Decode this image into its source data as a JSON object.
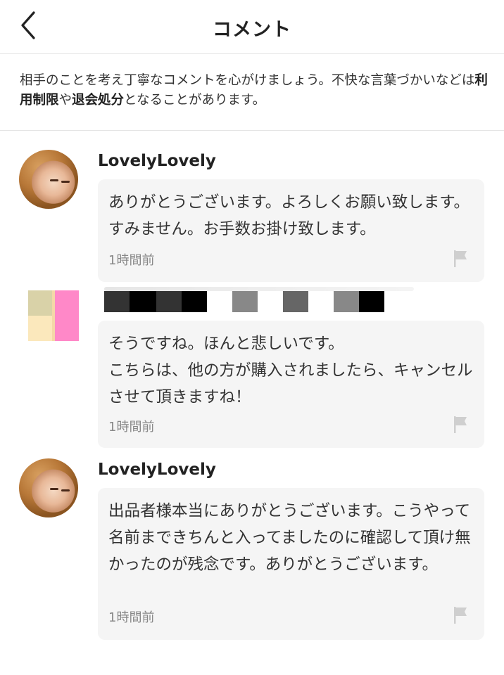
{
  "header": {
    "title": "コメント"
  },
  "notice": {
    "part1": "相手のことを考え丁寧なコメントを心がけましょう。不快な言葉づかいなどは",
    "bold1": "利用制限",
    "part2": "や",
    "bold2": "退会処分",
    "part3": "となることがあります。"
  },
  "comments": [
    {
      "username": "LovelyLovely",
      "text": "ありがとうございます。よろしくお願い致します。すみません。お手数お掛け致します。",
      "time": "1時間前"
    },
    {
      "username": "",
      "text": "そうですね。ほんと悲しいです。\nこちらは、他の方が購入されましたら、キャンセルさせて頂きますね！",
      "time": "1時間前"
    },
    {
      "username": "LovelyLovely",
      "text": "出品者様本当にありがとうございます。こうやって名前まできちんと入ってましたのに確認して頂け無かったのが残念です。ありがとうございます。",
      "time": "1時間前"
    }
  ],
  "icons": {
    "back": "chevron-left-icon",
    "flag": "flag-icon"
  },
  "colors": {
    "bubble_bg": "#f5f5f5",
    "divider": "#e4e4e4",
    "flag": "#cfcfcf"
  }
}
